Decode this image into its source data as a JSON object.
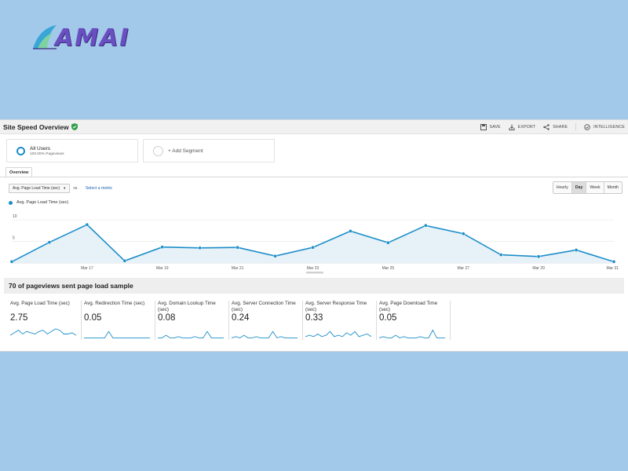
{
  "logo": {
    "text": "AMAI"
  },
  "header": {
    "title": "Site Speed Overview",
    "actions": [
      {
        "label": "SAVE",
        "icon": "save-icon"
      },
      {
        "label": "EXPORT",
        "icon": "export-icon"
      },
      {
        "label": "SHARE",
        "icon": "share-icon"
      },
      {
        "label": "INTELLIGENCE",
        "icon": "intelligence-icon"
      }
    ]
  },
  "segments": [
    {
      "name": "All Users",
      "sub": "100.00% Pageviews"
    },
    {
      "name": "+ Add Segment"
    }
  ],
  "tabs": [
    {
      "label": "Overview"
    }
  ],
  "metric": {
    "selected": "Avg. Page Load Time (sec)",
    "vs": "vs.",
    "select_label": "Select a metric"
  },
  "granularity": [
    "Hourly",
    "Day",
    "Week",
    "Month"
  ],
  "granularity_active": "Day",
  "colors": {
    "series": "#1c8ec9",
    "fill": "#e6f1f8",
    "page_bg": "#a3c9ea"
  },
  "chart_data": {
    "type": "area",
    "series": [
      {
        "name": "Avg. Page Load Time (sec)",
        "values": [
          0.3,
          4.8,
          8.9,
          0.5,
          3.7,
          3.5,
          3.6,
          1.6,
          3.6,
          7.4,
          4.7,
          8.7,
          6.8,
          1.9,
          1.5,
          3.0,
          0.3
        ]
      }
    ],
    "x_tick_labels": [
      "Mar 17",
      "Mar 19",
      "Mar 21",
      "Mar 23",
      "Mar 25",
      "Mar 27",
      "Mar 29",
      "Mar 31"
    ],
    "x_tick_index": [
      2,
      4,
      6,
      8,
      10,
      12,
      14,
      16
    ],
    "y_ticks": [
      5,
      10
    ],
    "ylim": [
      0,
      11.3
    ],
    "legend": "top-left",
    "grid": true
  },
  "summary": {
    "text": "70 of pageviews sent page load sample"
  },
  "cards": [
    {
      "label": "Avg. Page Load Time (sec)",
      "value": "2.75",
      "spark": [
        3,
        5,
        7,
        4,
        6,
        5,
        4,
        6,
        7,
        4,
        6,
        8,
        7,
        4,
        4,
        5,
        3
      ]
    },
    {
      "label": "Avg. Redirection Time (sec)",
      "value": "0.05",
      "spark": [
        1,
        1,
        1,
        1,
        1,
        1,
        6,
        1,
        1,
        1,
        1,
        1,
        1,
        1,
        1,
        1,
        1
      ]
    },
    {
      "label": "Avg. Domain Lookup Time (sec)",
      "value": "0.08",
      "spark": [
        1,
        1,
        3,
        1,
        1,
        2,
        1,
        1,
        1,
        2,
        1,
        1,
        6,
        1,
        1,
        1,
        1
      ]
    },
    {
      "label": "Avg. Server Connection Time (sec)",
      "value": "0.24",
      "spark": [
        1,
        2,
        1,
        3,
        1,
        1,
        2,
        1,
        1,
        1,
        6,
        1,
        2,
        1,
        1,
        1,
        1
      ]
    },
    {
      "label": "Avg. Server Response Time (sec)",
      "value": "0.33",
      "spark": [
        2,
        3,
        2,
        4,
        2,
        3,
        6,
        2,
        3,
        2,
        5,
        3,
        6,
        2,
        3,
        4,
        2
      ]
    },
    {
      "label": "Avg. Page Download Time (sec)",
      "value": "0.05",
      "spark": [
        1,
        2,
        1,
        1,
        3,
        1,
        2,
        1,
        1,
        1,
        2,
        1,
        1,
        7,
        1,
        1,
        1
      ]
    }
  ]
}
